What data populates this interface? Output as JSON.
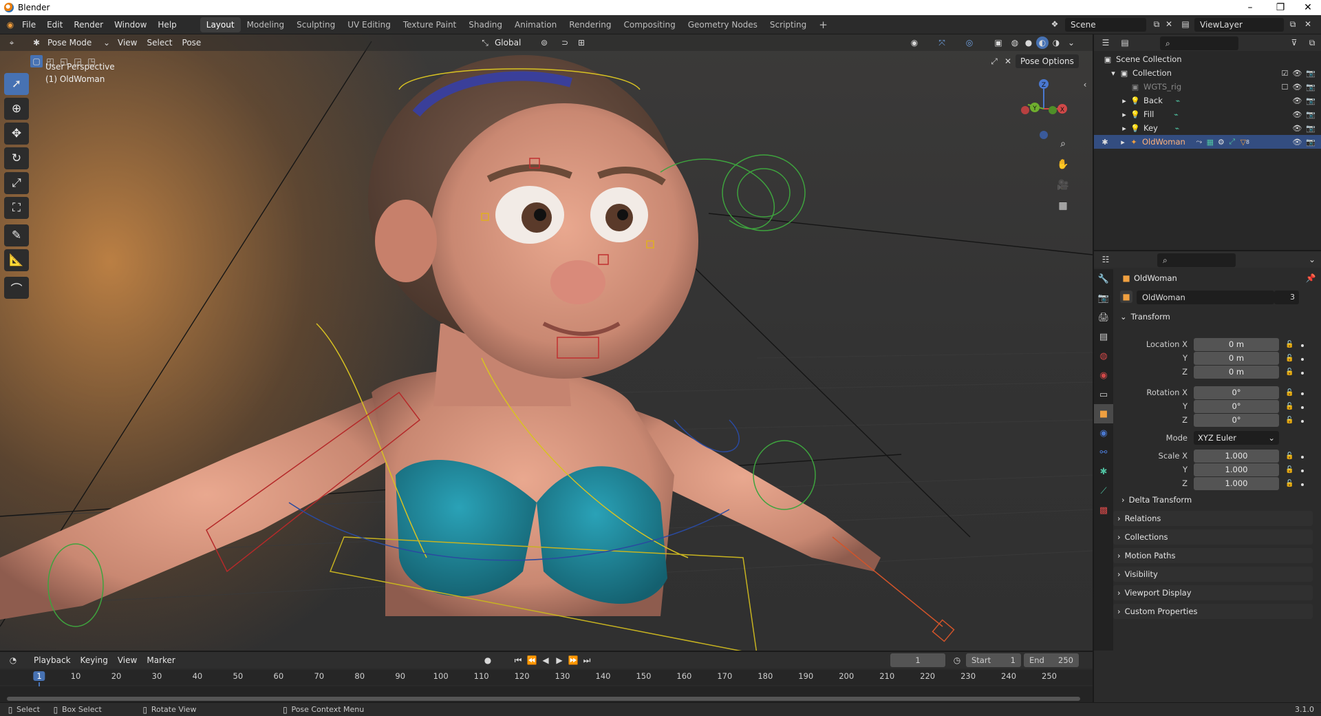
{
  "window": {
    "title": "Blender"
  },
  "menubar": {
    "menus": [
      "File",
      "Edit",
      "Render",
      "Window",
      "Help"
    ],
    "workspaces": [
      "Layout",
      "Modeling",
      "Sculpting",
      "UV Editing",
      "Texture Paint",
      "Shading",
      "Animation",
      "Rendering",
      "Compositing",
      "Geometry Nodes",
      "Scripting"
    ],
    "active_workspace": "Layout",
    "add_workspace": "+",
    "scene": "Scene",
    "view_layer": "ViewLayer"
  },
  "viewport": {
    "mode": "Pose Mode",
    "menus": [
      "View",
      "Select",
      "Pose"
    ],
    "orientation": "Global",
    "pose_options": "Pose Options",
    "overlay_line1": "User Perspective",
    "overlay_line2": "(1) OldWoman",
    "gizmo": {
      "z": "Z",
      "y": "Y",
      "x": "X"
    }
  },
  "outliner": {
    "root": "Scene Collection",
    "collection": "Collection",
    "items": [
      {
        "label": "WGTS_rig"
      },
      {
        "label": "Back"
      },
      {
        "label": "Fill"
      },
      {
        "label": "Key"
      },
      {
        "label": "OldWoman",
        "selected": true
      }
    ],
    "badge": "8"
  },
  "properties": {
    "object_name": "OldWoman",
    "datablock_name": "OldWoman",
    "datablock_users": "3",
    "transform_label": "Transform",
    "location": {
      "label": "Location X",
      "x": "0 m",
      "y": "0 m",
      "z": "0 m"
    },
    "rotation": {
      "label": "Rotation X",
      "x": "0°",
      "y": "0°",
      "z": "0°"
    },
    "mode_label": "Mode",
    "mode_value": "XYZ Euler",
    "scale": {
      "label": "Scale X",
      "x": "1.000",
      "y": "1.000",
      "z": "1.000"
    },
    "axis_y": "Y",
    "axis_z": "Z",
    "delta_transform": "Delta Transform",
    "panels": [
      "Relations",
      "Collections",
      "Motion Paths",
      "Visibility",
      "Viewport Display",
      "Custom Properties"
    ]
  },
  "timeline": {
    "menus": [
      "Playback",
      "Keying",
      "View",
      "Marker"
    ],
    "current_frame": "1",
    "start_label": "Start",
    "start": "1",
    "end_label": "End",
    "end": "250",
    "ruler": [
      "1",
      "10",
      "20",
      "30",
      "40",
      "50",
      "60",
      "70",
      "80",
      "90",
      "100",
      "110",
      "120",
      "130",
      "140",
      "150",
      "160",
      "170",
      "180",
      "190",
      "200",
      "210",
      "220",
      "230",
      "240",
      "250"
    ]
  },
  "statusbar": {
    "select": "Select",
    "box_select": "Box Select",
    "rotate_view": "Rotate View",
    "pose_context_menu": "Pose Context Menu",
    "version": "3.1.0"
  },
  "colors": {
    "accent": "#4772b3",
    "selected_row": "#334d80",
    "header": "#2b2b2b"
  }
}
